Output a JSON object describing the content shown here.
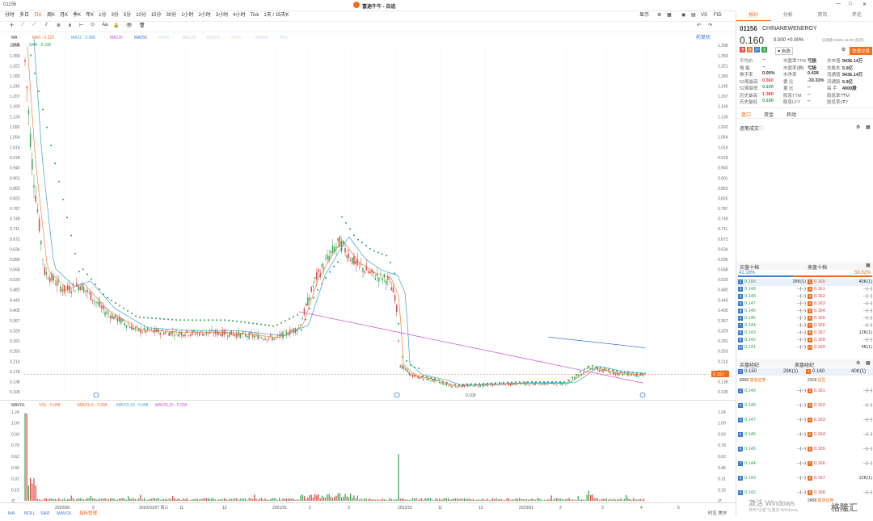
{
  "app": {
    "title": "富途牛牛 - 自选",
    "stock_code_tab": "01156",
    "window_controls": [
      "minimize-icon",
      "maximize-icon",
      "close-icon"
    ]
  },
  "period_tabs": [
    "分时",
    "多日",
    "日K",
    "周K",
    "月K",
    "季K",
    "年K",
    "1分",
    "3分",
    "5分",
    "10分",
    "15分",
    "30分",
    "1小时",
    "2小时",
    "3小时",
    "4小时",
    "Tick",
    "1天 / 15天K"
  ],
  "period_selected": 2,
  "toolbar_right": {
    "display": "显示",
    "vs": "VS",
    "fid": "FID"
  },
  "chart": {
    "restore_label": "前复权",
    "ma_legend": [
      {
        "name": "MA",
        "color": "#333333"
      },
      {
        "name": "MA5 : 0.323",
        "color": "#f56c1b"
      },
      {
        "name": "MA22 : 0.388",
        "color": "#3aa0d8"
      },
      {
        "name": "MA130",
        "color": "#c84fd0"
      },
      {
        "name": "MA250",
        "color": "#2a6fd6"
      },
      {
        "name": "MA60",
        "color": "#c9e3c9"
      },
      {
        "name": "MA175",
        "color": "#f0c0c0"
      },
      {
        "name": "MA300",
        "color": "#e0c8f0"
      },
      {
        "name": "MA55",
        "color": "#f4e1b0"
      },
      {
        "name": "MA250",
        "color": "#d8c8f0"
      },
      {
        "name": "MA1",
        "color": "#c8d8f0"
      }
    ],
    "sar_legend": {
      "name": "SAR",
      "value": "SAR : 0.108"
    },
    "price_ticks": [
      "1.398",
      "1.359",
      "1.321",
      "1.283",
      "1.245",
      "1.207",
      "1.169",
      "1.130",
      "1.092",
      "1.054",
      "1.016",
      "0.978",
      "0.940",
      "0.901",
      "0.863",
      "0.825",
      "0.787",
      "0.749",
      "0.711",
      "0.672",
      "0.634",
      "0.596",
      "0.558",
      "0.520",
      "0.482",
      "0.443",
      "0.405",
      "0.367",
      "0.329",
      "0.291",
      "0.253",
      "0.214",
      "0.176",
      "0.138",
      "0.100"
    ],
    "current_price_tag": "0.157",
    "low_marker": "0.100",
    "vol_legend": [
      {
        "name": "MAVOL",
        "color": "#333333"
      },
      {
        "name": "VOL : 0.008",
        "color": "#f56c1b"
      },
      {
        "name": "MAVOL5 : 0.008",
        "color": "#f56c1b"
      },
      {
        "name": "MAVOL10 : 0.008",
        "color": "#3aa0d8"
      },
      {
        "name": "MAVOL20 : 0.009",
        "color": "#c84fd0"
      }
    ],
    "vol_ticks": [
      "1.24",
      "1.09",
      "0.93",
      "0.78",
      "0.62",
      "0.46",
      "0.31",
      "0.15",
      "亿"
    ],
    "date_ticks": [
      "2020/08",
      "9",
      "2020/10/07 周三",
      "11",
      "12",
      "2021/01",
      "2",
      "3",
      "2022/10",
      "11",
      "12",
      "2023/01",
      "2",
      "3",
      "4",
      "5"
    ],
    "bottom_tools": [
      "MA",
      "BOLL",
      "SAR",
      "MAVOL",
      "指标管理"
    ],
    "bottom_right": "时区 美东"
  },
  "quote": {
    "tabs": [
      "报价",
      "分析",
      "资讯",
      "评论"
    ],
    "code": "01156",
    "name": "CHINANEWENERGY",
    "price": "0.160",
    "change": "0.000 +0.00%",
    "time": "已收盘 04/03 16:08 (北京)",
    "badges": [
      "港",
      "通",
      "沪",
      "深"
    ],
    "fav": "自选",
    "trade_button": "快速交易",
    "stats_left": [
      [
        "平均价",
        "--"
      ],
      [
        "振 幅",
        "--"
      ],
      [
        "换手率",
        "0.00%"
      ],
      [
        "52周最高",
        "0.360"
      ],
      [
        "52周最低",
        "0.100"
      ],
      [
        "历史最高",
        "1.380"
      ],
      [
        "历史最低",
        "0.100"
      ]
    ],
    "stats_mid": [
      [
        "市盈率TTM",
        "亏损"
      ],
      [
        "市盈率(静)",
        "亏损"
      ],
      [
        "市净率",
        "0.428"
      ],
      [
        "委 比",
        "-33.33%"
      ],
      [
        "量 比",
        "--"
      ],
      [
        "股息TTM",
        "--"
      ],
      [
        "股息LFY",
        "--"
      ]
    ],
    "stats_mid2": [
      [
        "总市值",
        "9436.14万"
      ],
      [
        "总股本",
        "5.9亿"
      ],
      [
        "流通值",
        "9436.14万"
      ],
      [
        "流通股",
        "5.9亿"
      ],
      [
        "每 手",
        "4000股"
      ],
      [
        "股息率TTM",
        "--"
      ],
      [
        "股息率LFY",
        "--"
      ]
    ]
  },
  "subtabs": [
    "盘口",
    "资金",
    "异动"
  ],
  "tick_title": "逐笔成交",
  "book": {
    "bid_title": "买盘十档",
    "ask_title": "卖盘十档",
    "bid_pct": "41.18%",
    "ask_pct": "58.82%",
    "bid_fraction": 0.4118,
    "rows": [
      [
        "0.150",
        "28K(1)",
        "0.160",
        "40K(1)"
      ],
      [
        "0.149",
        "--(--)",
        "0.161",
        "--(--)"
      ],
      [
        "0.148",
        "--(--)",
        "0.162",
        "--(--)"
      ],
      [
        "0.147",
        "--(--)",
        "0.163",
        "--(--)"
      ],
      [
        "0.146",
        "--(--)",
        "0.164",
        "--(--)"
      ],
      [
        "0.145",
        "--(--)",
        "0.165",
        "--(--)"
      ],
      [
        "0.144",
        "--(--)",
        "0.166",
        "--(--)"
      ],
      [
        "0.143",
        "--(--)",
        "0.167",
        "12K(1)"
      ],
      [
        "0.142",
        "--(--)",
        "0.168",
        "--(--)"
      ],
      [
        "0.141",
        "--(--)",
        "0.169",
        "4K(1)"
      ]
    ],
    "broker_bid_title": "买盘经纪",
    "broker_ask_title": "卖盘经纪",
    "broker_top": [
      "0.150",
      "28K(1)",
      "0.160",
      "40K(1)"
    ],
    "broker_names": {
      "bid_id": "8308",
      "bid_name": "富途证券",
      "ask_id": "2318",
      "ask_name": "恒生"
    },
    "broker_rows": [
      [
        "0.149",
        "--(--)",
        "0.161",
        "--(--)"
      ],
      [
        "0.148",
        "--(--)",
        "0.162",
        "--(--)"
      ],
      [
        "0.147",
        "--(--)",
        "0.163",
        "--(--)"
      ],
      [
        "0.146",
        "--(--)",
        "0.164",
        "--(--)"
      ],
      [
        "0.145",
        "--(--)",
        "0.165",
        "--(--)"
      ],
      [
        "0.144",
        "--(--)",
        "0.166",
        "--(--)"
      ],
      [
        "0.143",
        "--(--)",
        "0.167",
        "12K(1)"
      ],
      [
        "0.142",
        "--(--)",
        "0.168",
        "--(--)"
      ]
    ],
    "broker_extra": {
      "id": "2458",
      "name": "富途证券"
    }
  },
  "watermark": {
    "activate": "激活 Windows",
    "hint": "转到\"设置\"以激活 Windows。",
    "logo": "格隆汇"
  }
}
